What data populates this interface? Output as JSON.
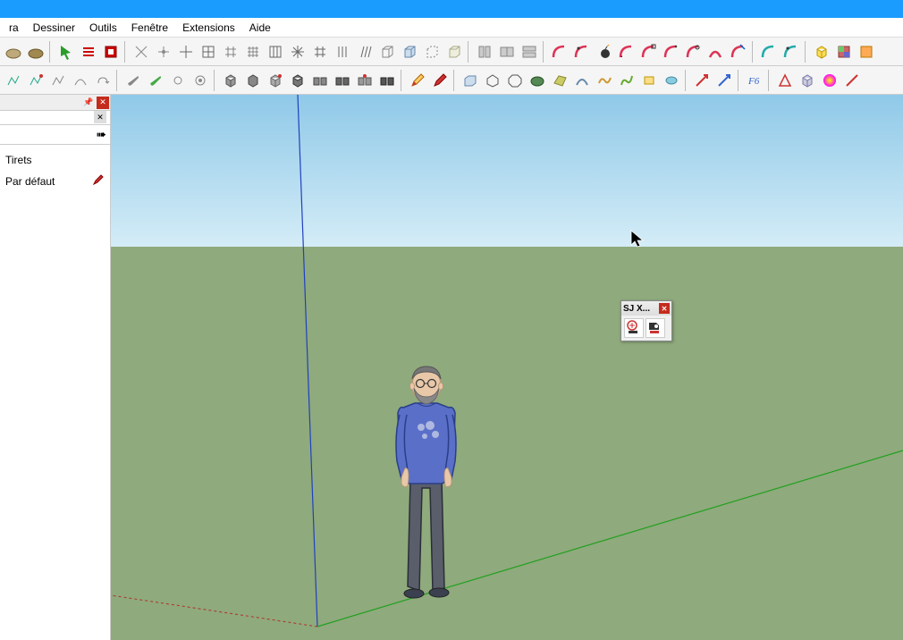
{
  "menu": {
    "items": [
      "ra",
      "Dessiner",
      "Outils",
      "Fenêtre",
      "Extensions",
      "Aide"
    ]
  },
  "sidepanel": {
    "row1_label": "Tirets",
    "row2_label": "Par défaut"
  },
  "float_panel": {
    "title": "SJ X..."
  }
}
